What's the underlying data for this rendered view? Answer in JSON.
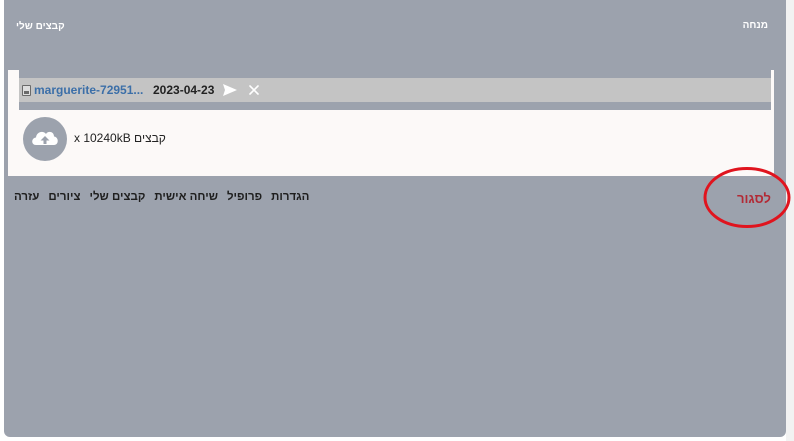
{
  "header": {
    "left_title": "קבצים שלי",
    "right_title": "מנחה"
  },
  "file": {
    "icon": "image-file-icon",
    "name": "marguerite-72951...",
    "date": "2023-04-23",
    "send_icon": "send-icon",
    "remove_icon": "close-icon"
  },
  "upload": {
    "icon": "cloud-upload-icon",
    "limit_text": "קבצים x 10240kB"
  },
  "menu": {
    "items": [
      "עזרה",
      "ציורים",
      "קבצים שלי",
      "שיחה אישית",
      "פרופיל",
      "הגדרות"
    ]
  },
  "close_label": "לסגור",
  "colors": {
    "frame": "#9ca2ad",
    "panel": "#fcf9f8",
    "file_bar": "#c4c4c4",
    "link": "#3c6fa8",
    "close_text": "#b22a35",
    "annotation": "#e0141e"
  }
}
